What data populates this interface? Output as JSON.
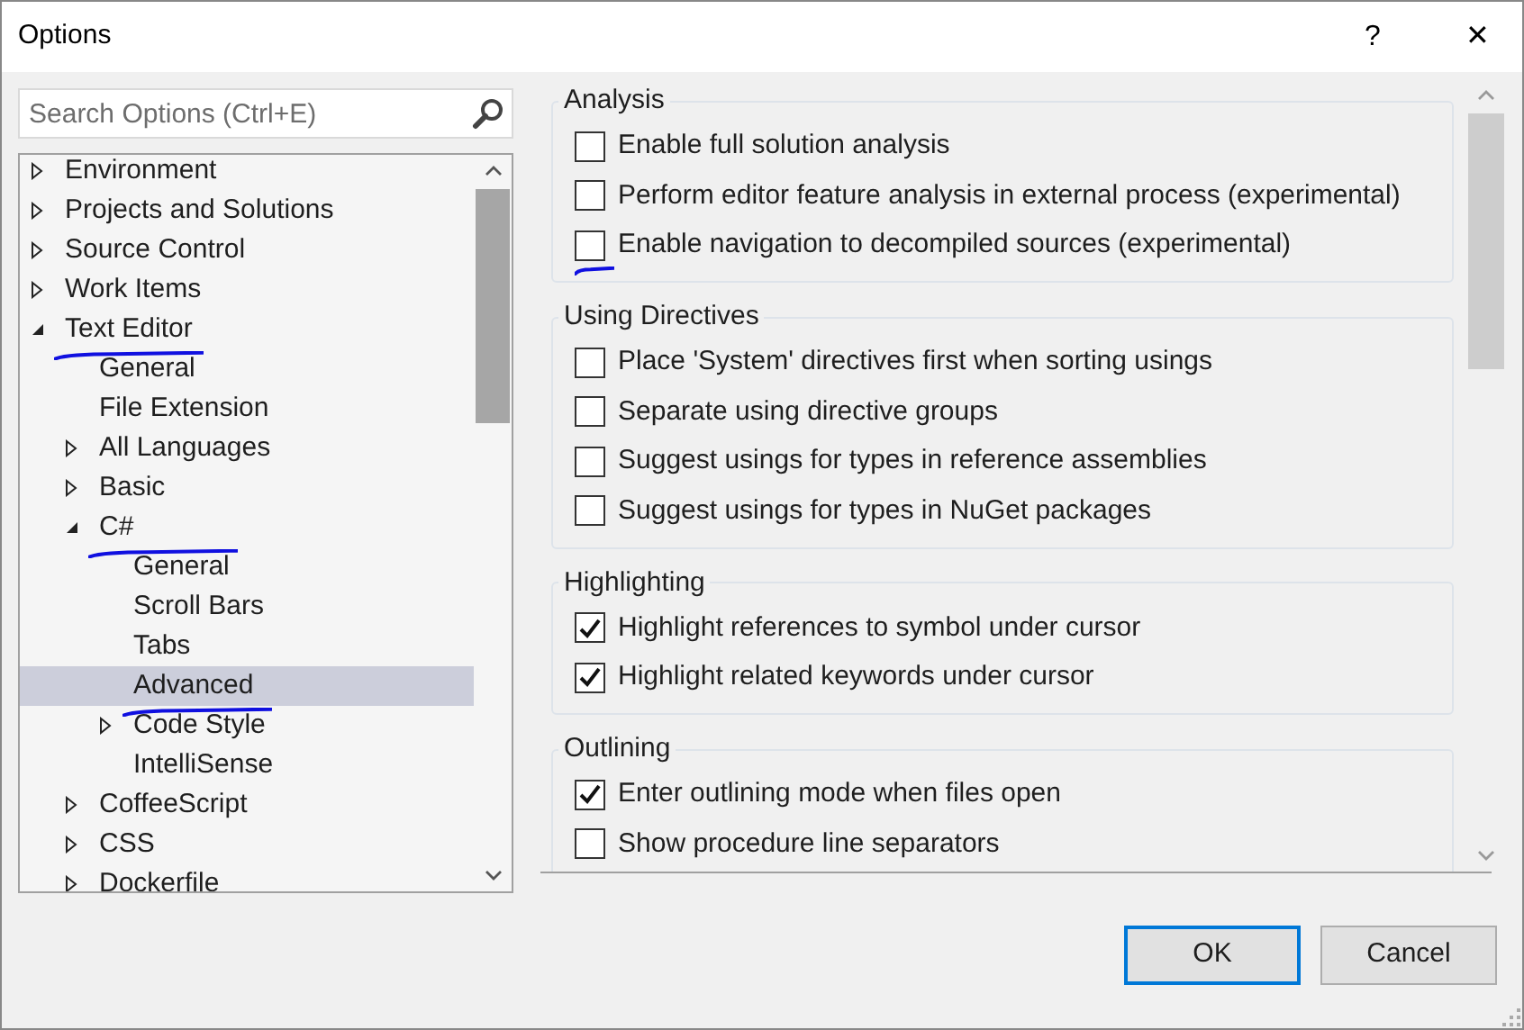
{
  "window": {
    "title": "Options",
    "help": "?",
    "close": "✕"
  },
  "search": {
    "placeholder": "Search Options (Ctrl+E)"
  },
  "tree": [
    {
      "label": "Environment",
      "kind": "folder",
      "expanded": false,
      "selected": false,
      "annotated": false
    },
    {
      "label": "Projects and Solutions",
      "kind": "folder",
      "expanded": false,
      "selected": false,
      "annotated": false
    },
    {
      "label": "Source Control",
      "kind": "folder",
      "expanded": false,
      "selected": false,
      "annotated": false
    },
    {
      "label": "Work Items",
      "kind": "folder",
      "expanded": false,
      "selected": false,
      "annotated": false
    },
    {
      "label": "Text Editor",
      "kind": "folder",
      "expanded": true,
      "selected": false,
      "annotated": true,
      "children": [
        {
          "label": "General",
          "kind": "page",
          "selected": false,
          "annotated": false
        },
        {
          "label": "File Extension",
          "kind": "page",
          "selected": false,
          "annotated": false
        },
        {
          "label": "All Languages",
          "kind": "folder",
          "expanded": false,
          "selected": false,
          "annotated": false
        },
        {
          "label": "Basic",
          "kind": "folder",
          "expanded": false,
          "selected": false,
          "annotated": false
        },
        {
          "label": "C#",
          "kind": "folder",
          "expanded": true,
          "selected": false,
          "annotated": true,
          "children": [
            {
              "label": "General",
              "kind": "page",
              "selected": false,
              "annotated": false
            },
            {
              "label": "Scroll Bars",
              "kind": "page",
              "selected": false,
              "annotated": false
            },
            {
              "label": "Tabs",
              "kind": "page",
              "selected": false,
              "annotated": false
            },
            {
              "label": "Advanced",
              "kind": "page",
              "selected": true,
              "annotated": true
            },
            {
              "label": "Code Style",
              "kind": "folder",
              "expanded": false,
              "selected": false,
              "annotated": false
            },
            {
              "label": "IntelliSense",
              "kind": "page",
              "selected": false,
              "annotated": false
            }
          ]
        },
        {
          "label": "CoffeeScript",
          "kind": "folder",
          "expanded": false,
          "selected": false,
          "annotated": false
        },
        {
          "label": "CSS",
          "kind": "folder",
          "expanded": false,
          "selected": false,
          "annotated": false
        },
        {
          "label": "Dockerfile",
          "kind": "folder",
          "expanded": false,
          "selected": false,
          "annotated": false
        }
      ]
    }
  ],
  "groups": [
    {
      "title": "Analysis",
      "options": [
        {
          "label": "Enable full solution analysis",
          "checked": false,
          "annotated": false
        },
        {
          "label": "Perform editor feature analysis in external process (experimental)",
          "checked": false,
          "annotated": false
        },
        {
          "label": "Enable navigation to decompiled sources (experimental)",
          "checked": false,
          "annotated": true
        }
      ]
    },
    {
      "title": "Using Directives",
      "options": [
        {
          "label": "Place 'System' directives first when sorting usings",
          "checked": false,
          "annotated": false
        },
        {
          "label": "Separate using directive groups",
          "checked": false,
          "annotated": false
        },
        {
          "label": "Suggest usings for types in reference assemblies",
          "checked": false,
          "annotated": false
        },
        {
          "label": "Suggest usings for types in NuGet packages",
          "checked": false,
          "annotated": false
        }
      ]
    },
    {
      "title": "Highlighting",
      "options": [
        {
          "label": "Highlight references to symbol under cursor",
          "checked": true,
          "annotated": false
        },
        {
          "label": "Highlight related keywords under cursor",
          "checked": true,
          "annotated": false
        }
      ]
    },
    {
      "title": "Outlining",
      "options": [
        {
          "label": "Enter outlining mode when files open",
          "checked": true,
          "annotated": false
        },
        {
          "label": "Show procedure line separators",
          "checked": false,
          "annotated": false
        }
      ]
    }
  ],
  "buttons": [
    {
      "label": "OK",
      "default": true
    },
    {
      "label": "Cancel",
      "default": false
    }
  ]
}
